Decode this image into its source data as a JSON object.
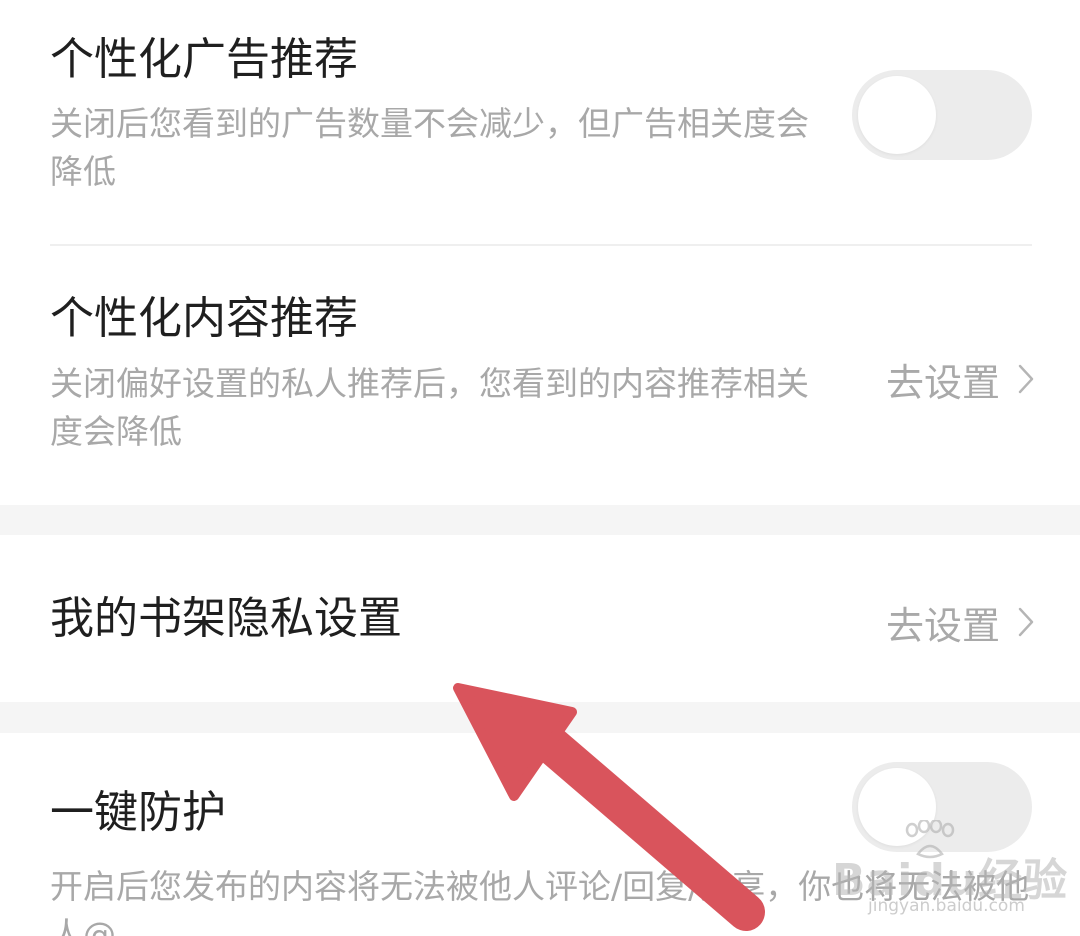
{
  "settings": {
    "ad_recommendation": {
      "title": "个性化广告推荐",
      "description": "关闭后您看到的广告数量不会减少，但广告相关度会降低",
      "enabled": false
    },
    "content_recommendation": {
      "title": "个性化内容推荐",
      "description": "关闭偏好设置的私人推荐后，您看到的内容推荐相关度会降低",
      "action_label": "去设置"
    },
    "bookshelf_privacy": {
      "title": "我的书架隐私设置",
      "action_label": "去设置"
    },
    "one_key_protection": {
      "title": "一键防护",
      "description": "开启后您发布的内容将无法被他人评论/回复/分享，你也将无法被他人@",
      "enabled": false
    }
  },
  "watermark": {
    "brand": "Bai",
    "brand_suffix": "du",
    "product": "经验",
    "url": "jingyan.baidu.com"
  },
  "colors": {
    "arrow": "#d9545c",
    "title_text": "#1f1f1f",
    "secondary_text": "#a8a8a8",
    "toggle_off_track": "#ececec",
    "section_gap": "#f5f5f5"
  }
}
